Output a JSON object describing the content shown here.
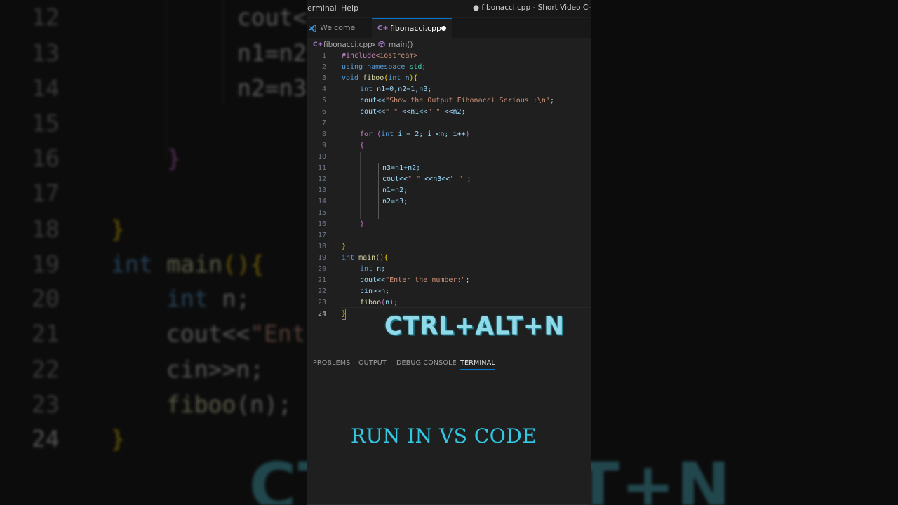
{
  "menubar": {
    "items": [
      "erminal",
      "Help"
    ],
    "window_title": "● fibonacci.cpp - Short Video C-"
  },
  "tabs": {
    "welcome": "Welcome",
    "file": "fibonacci.cpp"
  },
  "breadcrumb": {
    "file": "fibonacci.cpp",
    "separator": ">",
    "symbol": "main()"
  },
  "editor": {
    "line_numbers": [
      "1",
      "2",
      "3",
      "4",
      "5",
      "6",
      "7",
      "8",
      "9",
      "10",
      "11",
      "12",
      "13",
      "14",
      "15",
      "16",
      "17",
      "18",
      "19",
      "20",
      "21",
      "22",
      "23",
      "24"
    ],
    "lines": {
      "l1": {
        "pp": "#include",
        "inc": "<iostream>"
      },
      "l2": {
        "kw1": "using",
        "kw2": "namespace",
        "ns": "std",
        "semi": ";"
      },
      "l3": {
        "kw": "void",
        "fn": "fiboo",
        "open": "(",
        "kw2": "int",
        "param": "n",
        "close": ")",
        "brace": "{"
      },
      "l4": {
        "kw": "int",
        "rest": "n1=0,n2=1,n3;"
      },
      "l5": {
        "cout": "cout<<",
        "str": "\"Show the Output Fibonacci Serious :\\n\"",
        "semi": ";"
      },
      "l6": {
        "cout": "cout<<",
        "s1": "\" \"",
        "mid": "<<n1<<",
        "s2": "\" \"",
        "end": "<<n2;"
      },
      "l8": {
        "kw": "for",
        "open": " (",
        "kw2": "int",
        "rest": " i = 2; i <n; i++",
        "close": ")"
      },
      "l9": {
        "brace": "{"
      },
      "l11": {
        "code": "n3=n1+n2;"
      },
      "l12": {
        "cout": "cout<<",
        "s1": "\" \"",
        "mid": "<<n3<<",
        "s2": "\" \"",
        "semi": ";"
      },
      "l13": {
        "code": "n1=n2;"
      },
      "l14": {
        "code": "n2=n3;"
      },
      "l16": {
        "brace": "}"
      },
      "l18": {
        "brace": "}"
      },
      "l19": {
        "kw": "int",
        "fn": "main",
        "paren": "()",
        "brace": "{"
      },
      "l20": {
        "kw": "int",
        "rest": "n;"
      },
      "l21": {
        "cout": "cout<<",
        "str": "\"Enter the number:\"",
        "semi": ";"
      },
      "l22": {
        "code": "cin>>n;"
      },
      "l23": {
        "fn": "fiboo",
        "open": "(",
        "arg": "n",
        "close": ")",
        "semi": ";"
      },
      "l24": {
        "brace": "}"
      }
    }
  },
  "overlays": {
    "shortcut": "CTRL+ALT+N",
    "caption": "RUN IN VS CODE"
  },
  "panel": {
    "tabs": [
      "PROBLEMS",
      "OUTPUT",
      "DEBUG CONSOLE",
      "TERMINAL"
    ],
    "active_tab": "TERMINAL"
  },
  "background": {
    "line_numbers": [
      "12",
      "13",
      "14",
      "15",
      "16",
      "17",
      "18",
      "19",
      "20",
      "21",
      "22",
      "23",
      "24"
    ],
    "code": {
      "b12": "cout<<",
      "b13": "n1=n2",
      "b14": "n2=n3",
      "b16": "}",
      "b18": "}",
      "b19_kw": "int",
      "b19_fn": "main",
      "b19_paren": "()",
      "b19_brace": "{",
      "b20_kw": "int",
      "b20_rest": "n;",
      "b21_cout": "cout<<",
      "b21_str": "\"Ent",
      "b22": "cin>>n;",
      "b23_fn": "fiboo",
      "b23_rest": "(n);",
      "b24": "}"
    },
    "big_text": "CTRL+ALT+N"
  },
  "colors": {
    "accent": "#0078d4",
    "overlay_cyan": "#36c6e0",
    "editor_bg": "#1f1f1f"
  }
}
